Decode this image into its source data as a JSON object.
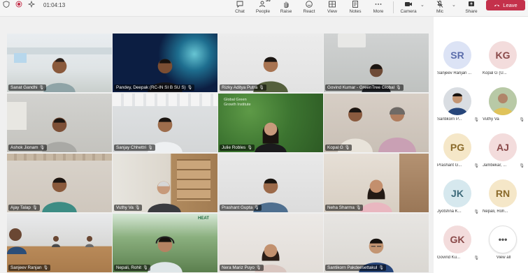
{
  "toolbar": {
    "timer": "01:04:13",
    "controls": {
      "chat": "Chat",
      "people": "People",
      "people_count": "36",
      "raise": "Raise",
      "react": "React",
      "view": "View",
      "notes": "Notes",
      "more": "More",
      "camera": "Camera",
      "mic": "Mic",
      "share": "Share"
    },
    "leave_label": "Leave",
    "colors": {
      "leave": "#c4314b",
      "toolbar_bg": "#f5f5f5"
    }
  },
  "grid": {
    "tiles": [
      {
        "name": "Sanat Gandhi"
      },
      {
        "name": "Pandey, Deepak (RC-IN SI B SU S)"
      },
      {
        "name": "Rizky Aditya Putra"
      },
      {
        "name": "Govind Kumar - GreenTree Global"
      },
      {
        "name": "Ashok Jionam"
      },
      {
        "name": "Sanjay Chhettri"
      },
      {
        "name": "Julie Robles",
        "wall_text": "Global Green Growth Institute"
      },
      {
        "name": "Kopal G"
      },
      {
        "name": "Ajay Talap"
      },
      {
        "name": "Vuthy Va"
      },
      {
        "name": "Prashant Gupta"
      },
      {
        "name": "Neha Sharma"
      },
      {
        "name": "Sanjeev Ranjan"
      },
      {
        "name": "Nepali, Rohit",
        "wall_text": "HEAT"
      },
      {
        "name": "Nera Mariz Puyo"
      },
      {
        "name": "Santikorn Pakdeesettakul"
      }
    ]
  },
  "roster": {
    "participants": [
      {
        "initials": "SR",
        "name": "Sanjeev Ranjan ...",
        "color": "#5b6dab",
        "bg": "#dce3f5"
      },
      {
        "initials": "KG",
        "name": "Kopal G (U...",
        "color": "#8a4a4a",
        "bg": "#f3dcdc"
      },
      {
        "initials": "",
        "name": "Santikorn P...",
        "photo": true
      },
      {
        "initials": "",
        "name": "Vuthy Va",
        "photo": true
      },
      {
        "initials": "PG",
        "name": "Prashant G...",
        "color": "#8a6a2a",
        "bg": "#f5e7c8"
      },
      {
        "initials": "AJ",
        "name": "Jambekar, ...",
        "color": "#8a4a4a",
        "bg": "#f3dcdc"
      },
      {
        "initials": "JK",
        "name": "Jyotshna K...",
        "color": "#3d6a7a",
        "bg": "#d6e8ee"
      },
      {
        "initials": "RN",
        "name": "Nepali, Roh...",
        "color": "#8a6a2a",
        "bg": "#f5e7c8"
      },
      {
        "initials": "GK",
        "name": "Govind Ku...",
        "color": "#8a4a4a",
        "bg": "#f3dcdc"
      },
      {
        "initials": "•••",
        "name": "View all",
        "viewall": true
      }
    ]
  }
}
